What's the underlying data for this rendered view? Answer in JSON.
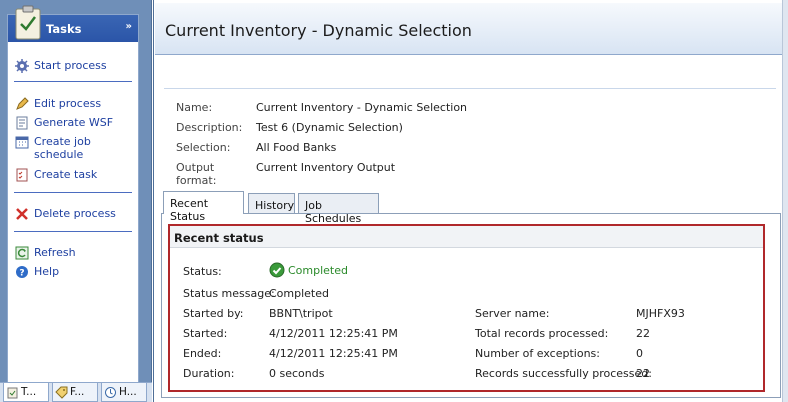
{
  "tasks_panel": {
    "title": "Tasks",
    "collapse_glyph": "»",
    "items": [
      {
        "label": "Start process",
        "icon": "gear-icon"
      },
      {
        "label": "Edit process",
        "icon": "pencil-icon"
      },
      {
        "label": "Generate WSF",
        "icon": "document-icon"
      },
      {
        "label": "Create job schedule",
        "icon": "calendar-icon"
      },
      {
        "label": "Create task",
        "icon": "checklist-icon"
      },
      {
        "label": "Delete process",
        "icon": "delete-x-icon"
      },
      {
        "label": "Refresh",
        "icon": "refresh-icon"
      },
      {
        "label": "Help",
        "icon": "help-icon"
      }
    ]
  },
  "bottom_tabs": [
    {
      "label": "T...",
      "icon": "clipboard-icon"
    },
    {
      "label": "F...",
      "icon": "tag-icon"
    },
    {
      "label": "H...",
      "icon": "history-icon"
    }
  ],
  "header": {
    "title": "Current Inventory - Dynamic Selection"
  },
  "info": {
    "name_label": "Name:",
    "name_value": "Current Inventory - Dynamic Selection",
    "description_label": "Description:",
    "description_value": "Test 6 (Dynamic Selection)",
    "selection_label": "Selection:",
    "selection_value": "All Food Banks",
    "output_label": "Output format:",
    "output_value": "Current Inventory Output"
  },
  "tabs": [
    "Recent Status",
    "History",
    "Job Schedules"
  ],
  "recent_status": {
    "heading": "Recent status",
    "status_label": "Status:",
    "status_value": "Completed",
    "message_label": "Status message:",
    "message_value": "Completed",
    "started_by_label": "Started by:",
    "started_by_value": "BBNT\\tripot",
    "started_label": "Started:",
    "started_value": "4/12/2011 12:25:41 PM",
    "ended_label": "Ended:",
    "ended_value": "4/12/2011 12:25:41 PM",
    "duration_label": "Duration:",
    "duration_value": "0 seconds",
    "server_label": "Server name:",
    "server_value": "MJHFX93",
    "total_label": "Total records processed:",
    "total_value": "22",
    "exceptions_label": "Number of exceptions:",
    "exceptions_value": "0",
    "success_label": "Records successfully processed:",
    "success_value": "22"
  },
  "colors": {
    "accent": "#2b55a8",
    "highlight": "#b0282b",
    "ok": "#2a8a2a",
    "link": "#1d3fa0"
  }
}
